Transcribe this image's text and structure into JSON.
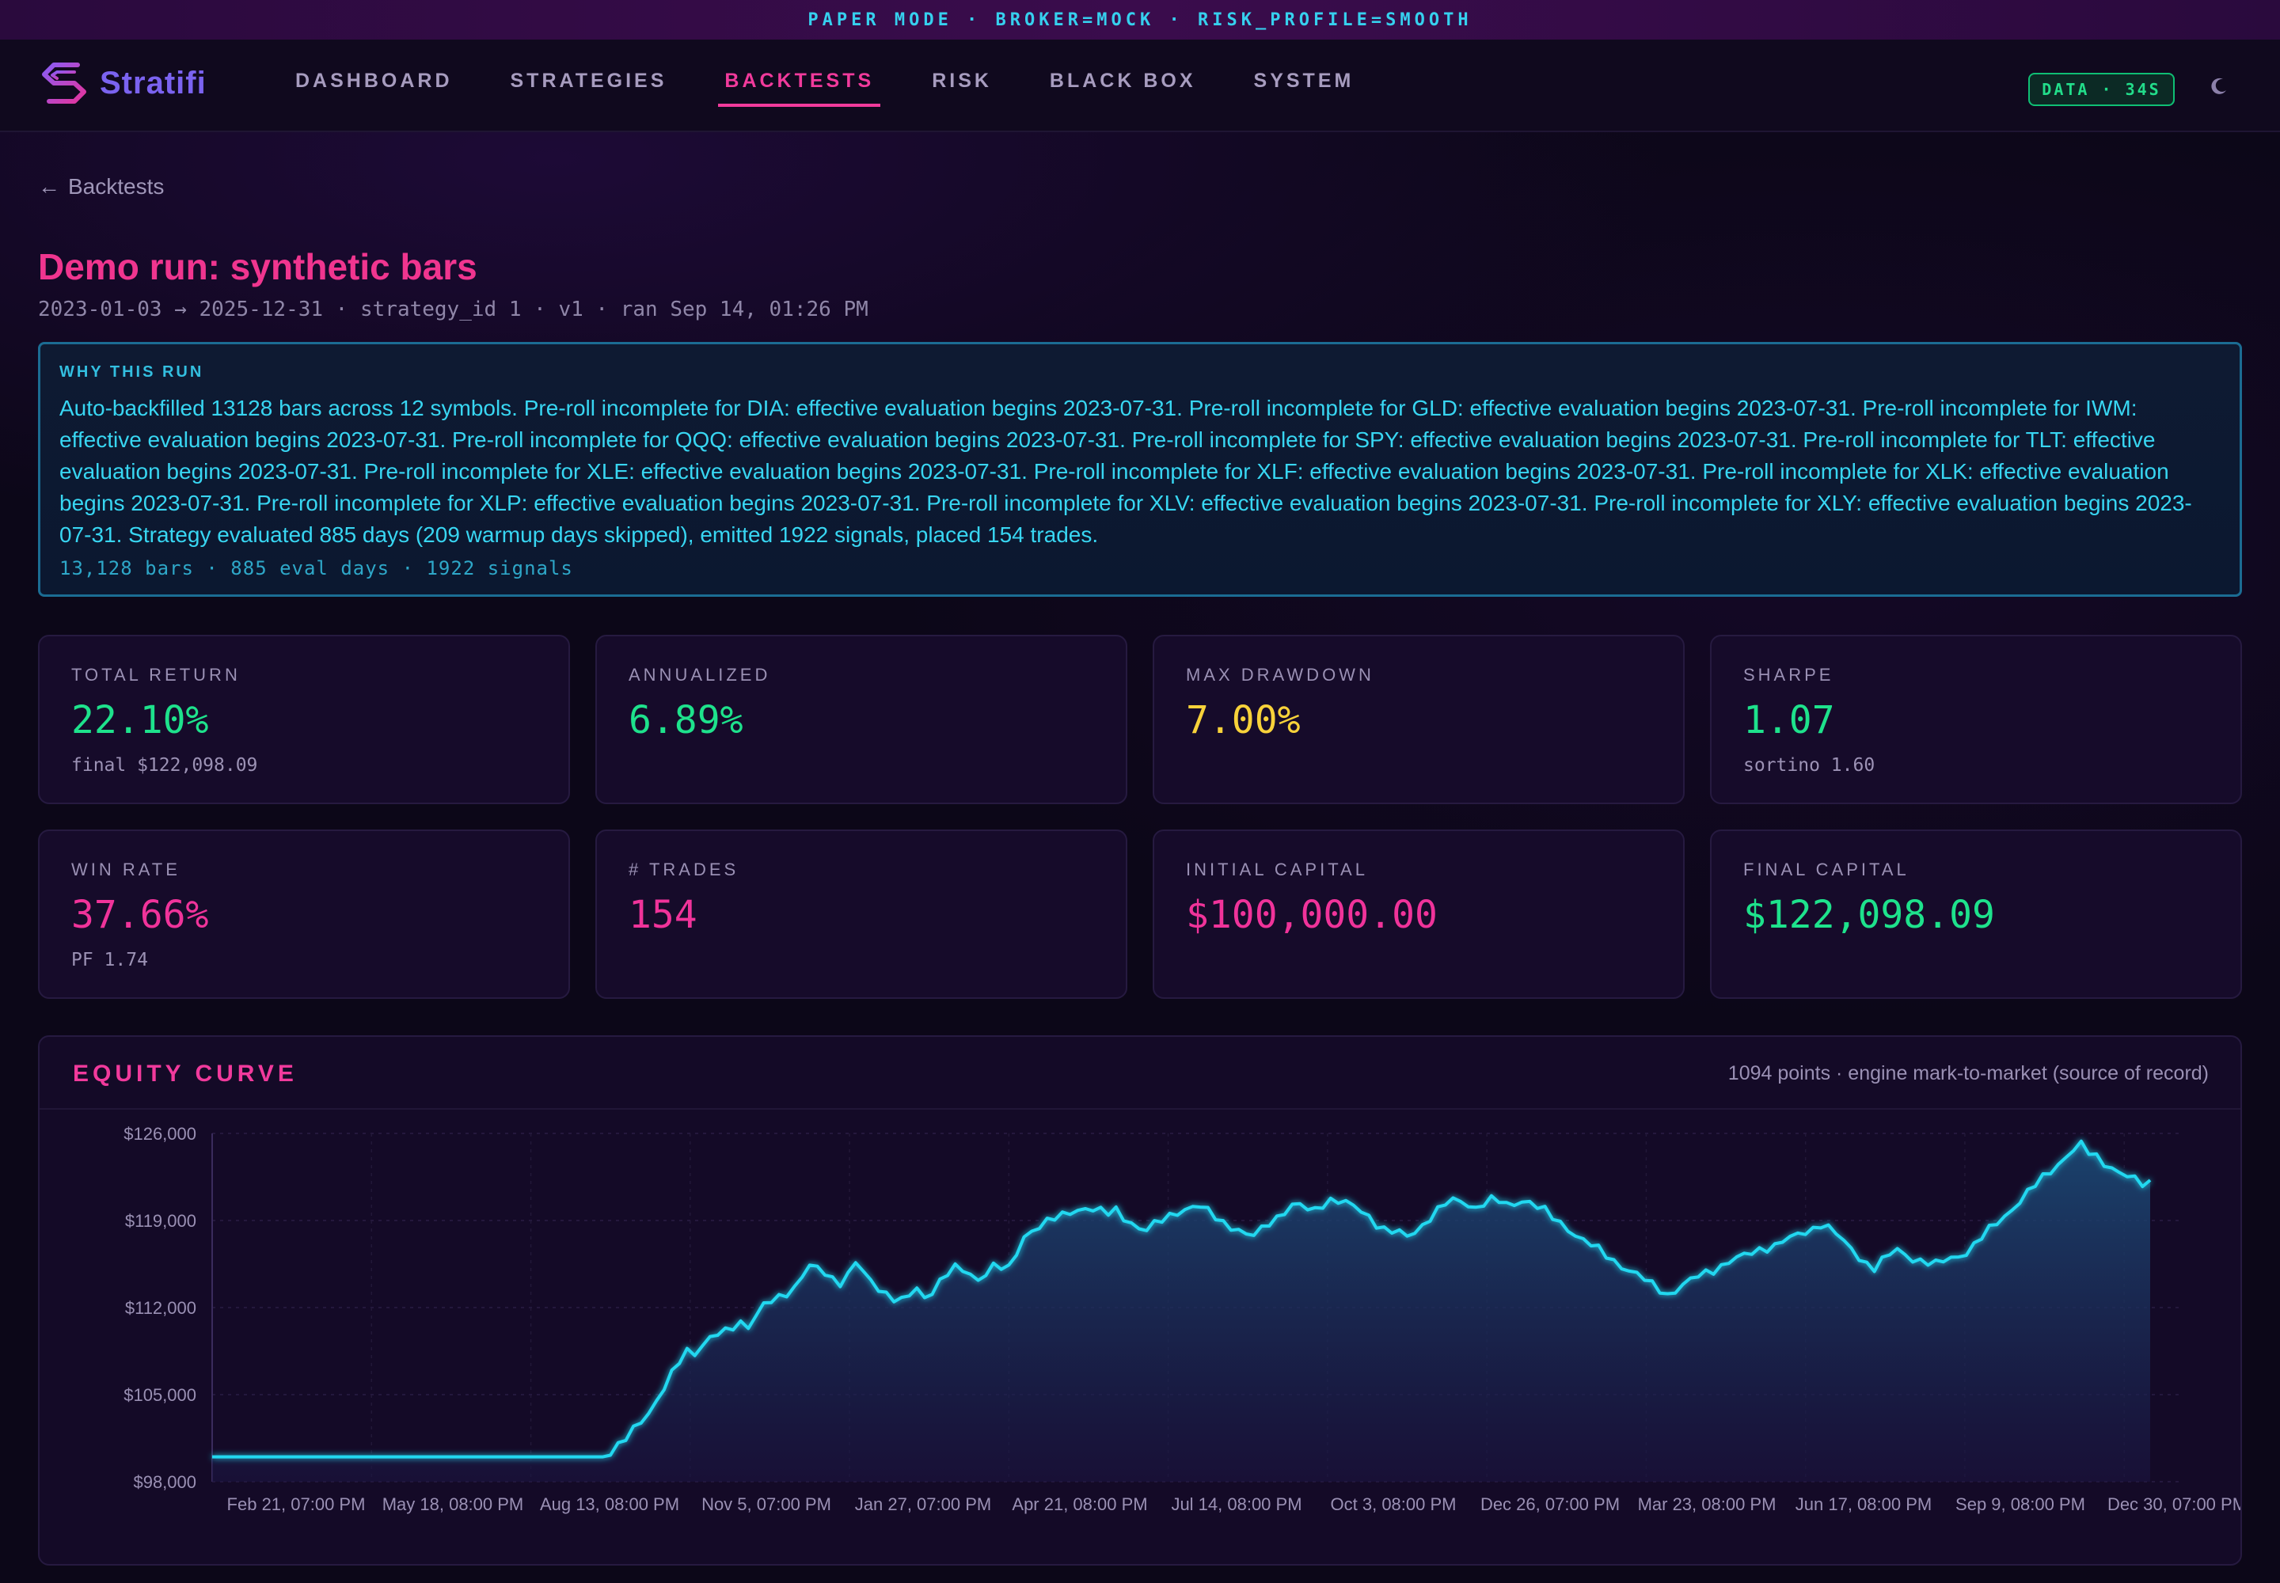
{
  "banner": "PAPER MODE · BROKER=MOCK · RISK_PROFILE=SMOOTH",
  "brand": {
    "name": "Stratifi",
    "accent": "#7b63f0"
  },
  "nav": {
    "items": [
      {
        "label": "DASHBOARD",
        "active": false
      },
      {
        "label": "STRATEGIES",
        "active": false
      },
      {
        "label": "BACKTESTS",
        "active": true
      },
      {
        "label": "RISK",
        "active": false
      },
      {
        "label": "BLACK BOX",
        "active": false
      },
      {
        "label": "SYSTEM",
        "active": false
      }
    ],
    "data_badge": "DATA · 34S",
    "theme_icon": "moon-icon"
  },
  "back_link": "Backtests",
  "run": {
    "title": "Demo run: synthetic bars",
    "subtitle": "2023-01-03 → 2025-12-31 · strategy_id 1 · v1 · ran Sep 14, 01:26 PM"
  },
  "why": {
    "label": "WHY THIS RUN",
    "text": "Auto-backfilled 13128 bars across 12 symbols. Pre-roll incomplete for DIA: effective evaluation begins 2023-07-31. Pre-roll incomplete for GLD: effective evaluation begins 2023-07-31. Pre-roll incomplete for IWM: effective evaluation begins 2023-07-31. Pre-roll incomplete for QQQ: effective evaluation begins 2023-07-31. Pre-roll incomplete for SPY: effective evaluation begins 2023-07-31. Pre-roll incomplete for TLT: effective evaluation begins 2023-07-31. Pre-roll incomplete for XLE: effective evaluation begins 2023-07-31. Pre-roll incomplete for XLF: effective evaluation begins 2023-07-31. Pre-roll incomplete for XLK: effective evaluation begins 2023-07-31. Pre-roll incomplete for XLP: effective evaluation begins 2023-07-31. Pre-roll incomplete for XLV: effective evaluation begins 2023-07-31. Pre-roll incomplete for XLY: effective evaluation begins 2023-07-31. Strategy evaluated 885 days (209 warmup days skipped), emitted 1922 signals, placed 154 trades.",
    "footer": "13,128 bars · 885 eval days · 1922 signals"
  },
  "stats": [
    {
      "label": "TOTAL RETURN",
      "value": "22.10%",
      "sub": "final $122,098.09",
      "tone": "green"
    },
    {
      "label": "ANNUALIZED",
      "value": "6.89%",
      "sub": "",
      "tone": "green"
    },
    {
      "label": "MAX DRAWDOWN",
      "value": "7.00%",
      "sub": "",
      "tone": "yellow"
    },
    {
      "label": "SHARPE",
      "value": "1.07",
      "sub": "sortino 1.60",
      "tone": "green"
    },
    {
      "label": "WIN RATE",
      "value": "37.66%",
      "sub": "PF 1.74",
      "tone": "pink"
    },
    {
      "label": "# TRADES",
      "value": "154",
      "sub": "",
      "tone": "pink"
    },
    {
      "label": "INITIAL CAPITAL",
      "value": "$100,000.00",
      "sub": "",
      "tone": "pink"
    },
    {
      "label": "FINAL CAPITAL",
      "value": "$122,098.09",
      "sub": "",
      "tone": "green"
    }
  ],
  "colors": {
    "green": "#1ee28c",
    "yellow": "#f8d23a",
    "pink": "#f0339a",
    "cyan": "#20d8f0"
  },
  "equity": {
    "title": "EQUITY CURVE",
    "meta": "1094 points · engine mark-to-market (source of record)"
  },
  "chart_data": {
    "type": "area",
    "title": "EQUITY CURVE",
    "xlabel": "",
    "ylabel": "",
    "ylim": [
      98000,
      126000
    ],
    "y_ticks": [
      "$98,000",
      "$105,000",
      "$112,000",
      "$119,000",
      "$126,000"
    ],
    "y_tick_values": [
      98000,
      105000,
      112000,
      119000,
      126000
    ],
    "x_ticks": [
      "Feb 21, 07:00 PM",
      "May 18, 08:00 PM",
      "Aug 13, 08:00 PM",
      "Nov 5, 07:00 PM",
      "Jan 27, 07:00 PM",
      "Apr 21, 08:00 PM",
      "Jul 14, 08:00 PM",
      "Oct 3, 08:00 PM",
      "Dec 26, 07:00 PM",
      "Mar 23, 08:00 PM",
      "Jun 17, 08:00 PM",
      "Sep 9, 08:00 PM",
      "Dec 30, 07:00 PM"
    ],
    "grid": true,
    "series": [
      {
        "values": [
          100000,
          100000,
          100000,
          100000,
          100000,
          100000,
          100000,
          100000,
          100000,
          100000,
          100000,
          100000,
          100000,
          100000,
          100000,
          100000,
          100000,
          100000,
          100000,
          100000,
          100000,
          100000,
          100000,
          100000,
          100000,
          100000,
          100000,
          100000,
          100000,
          100000,
          100000,
          100000,
          100000,
          100000,
          100000,
          100000,
          100000,
          100000,
          100000,
          100000,
          100000,
          100000,
          100000,
          100000,
          100000,
          100000,
          100000,
          100000,
          100000,
          100000,
          100000,
          100000,
          100200,
          100700,
          101500,
          102400,
          103000,
          103600,
          104300,
          105400,
          106600,
          107800,
          108700,
          108400,
          108900,
          109400,
          109800,
          110100,
          110600,
          110900,
          110500,
          111200,
          112100,
          112500,
          112900,
          113300,
          113600,
          114500,
          115200,
          115100,
          114800,
          114400,
          114100,
          114600,
          115600,
          114700,
          114100,
          113600,
          113200,
          112800,
          112500,
          112900,
          113400,
          112800,
          113400,
          114200,
          114800,
          115100,
          114900,
          114600,
          114300,
          114900,
          115400,
          115200,
          115000,
          116300,
          117700,
          118300,
          118600,
          118900,
          119100,
          119300,
          119700,
          119900,
          120100,
          119900,
          119700,
          119500,
          119800,
          119300,
          118900,
          118400,
          118200,
          118600,
          119000,
          119400,
          119800,
          119900,
          120100,
          120000,
          119700,
          119300,
          118900,
          118600,
          118200,
          117800,
          117700,
          118300,
          118900,
          119300,
          119800,
          120100,
          120200,
          119800,
          119900,
          120400,
          120700,
          120600,
          120300,
          120100,
          119700,
          119400,
          118800,
          118300,
          118100,
          117900,
          117700,
          118100,
          118700,
          119300,
          119800,
          120300,
          120500,
          120600,
          120300,
          120100,
          120400,
          120600,
          120500,
          120200,
          120400,
          120700,
          120500,
          120100,
          119700,
          119200,
          118800,
          118400,
          117900,
          117400,
          117000,
          116600,
          116200,
          115800,
          115400,
          115000,
          114600,
          114200,
          113800,
          113500,
          113100,
          113400,
          113800,
          114100,
          114500,
          114800,
          115100,
          115400,
          115700,
          115900,
          116100,
          116400,
          116700,
          116900,
          117000,
          117300,
          117500,
          117800,
          118100,
          118400,
          118800,
          118400,
          117900,
          117200,
          116700,
          116100,
          115600,
          115200,
          115700,
          116200,
          116600,
          116300,
          116000,
          115800,
          115600,
          115400,
          115700,
          116000,
          116200,
          116500,
          117000,
          117600,
          118200,
          118800,
          119400,
          120000,
          120600,
          121200,
          121800,
          122400,
          123000,
          123600,
          124200,
          124700,
          125000,
          124400,
          124100,
          123700,
          123300,
          122900,
          122500,
          122200,
          121900,
          122098
        ]
      }
    ]
  }
}
